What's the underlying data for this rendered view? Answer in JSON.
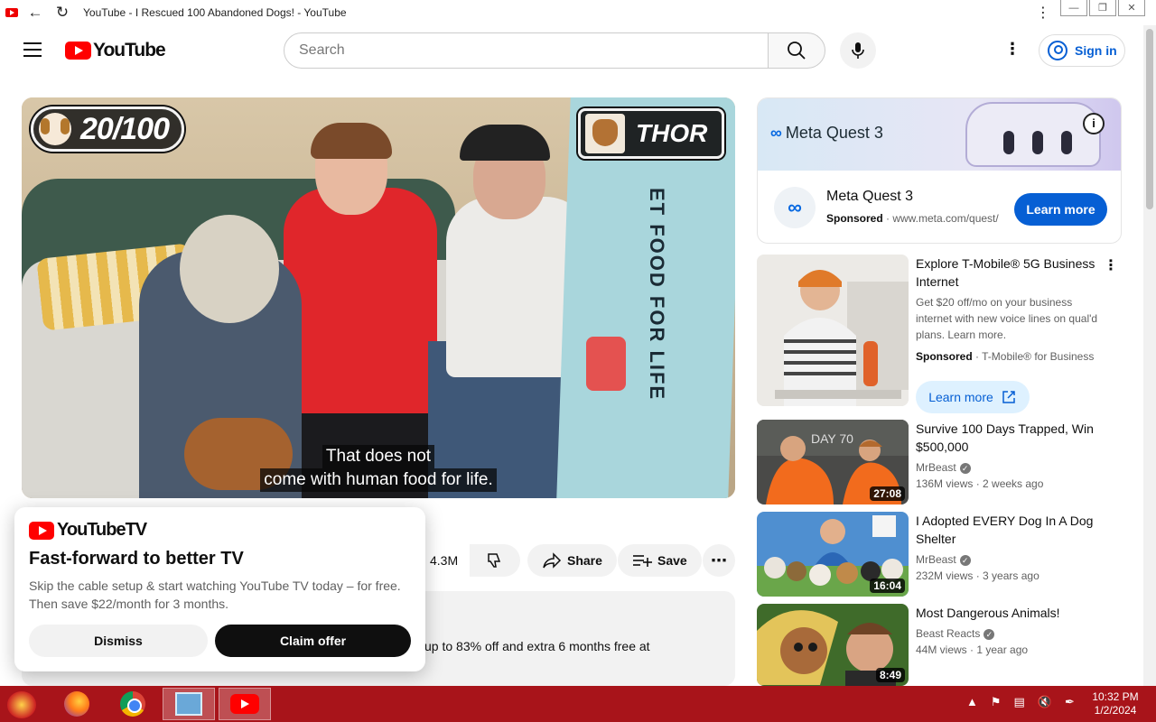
{
  "window": {
    "title": "YouTube - I Rescued 100 Abandoned Dogs! - YouTube",
    "controls": [
      "minimize",
      "restore",
      "close"
    ]
  },
  "masthead": {
    "logo_text": "YouTube",
    "search_placeholder": "Search",
    "sign_in_label": "Sign in"
  },
  "player": {
    "count_badge": "20/100",
    "dog_name_badge": "THOR",
    "caption_line1": "That does not",
    "caption_line2": "come with human food for life.",
    "sign_text": "ET FOOD FOR LIFE"
  },
  "actions": {
    "like_count": "4.3M",
    "share_label": "Share",
    "save_label": "Save"
  },
  "description": {
    "visible_text": "up to 83% off and extra 6 months free at"
  },
  "promo": {
    "logo_text": "YouTubeTV",
    "title": "Fast-forward to better TV",
    "body": "Skip the cable setup & start watching YouTube TV today – for free. Then save $22/month for 3 months.",
    "dismiss_label": "Dismiss",
    "claim_label": "Claim offer"
  },
  "sidebar_ad": {
    "banner_brand": "Meta Quest 3",
    "title": "Meta Quest 3",
    "sponsored": "Sponsored",
    "url": "www.meta.com/quest/",
    "cta": "Learn more"
  },
  "recommendations": [
    {
      "title": "Explore T-Mobile® 5G Business Internet",
      "description": "Get $20 off/mo on your business internet with new voice lines on qual'd plans. Learn more.",
      "sponsored": "Sponsored",
      "advertiser": "T-Mobile® for Business",
      "cta": "Learn more"
    },
    {
      "title": "Survive 100 Days Trapped, Win $500,000",
      "channel": "MrBeast",
      "views": "136M views",
      "age": "2 weeks ago",
      "duration": "27:08"
    },
    {
      "title": "I Adopted EVERY Dog In A Dog Shelter",
      "channel": "MrBeast",
      "views": "232M views",
      "age": "3 years ago",
      "duration": "16:04"
    },
    {
      "title": "Most Dangerous Animals!",
      "channel": "Beast Reacts",
      "views": "44M views",
      "age": "1 year ago",
      "duration": "8:49"
    }
  ],
  "taskbar": {
    "time": "10:32 PM",
    "date": "1/2/2024"
  }
}
